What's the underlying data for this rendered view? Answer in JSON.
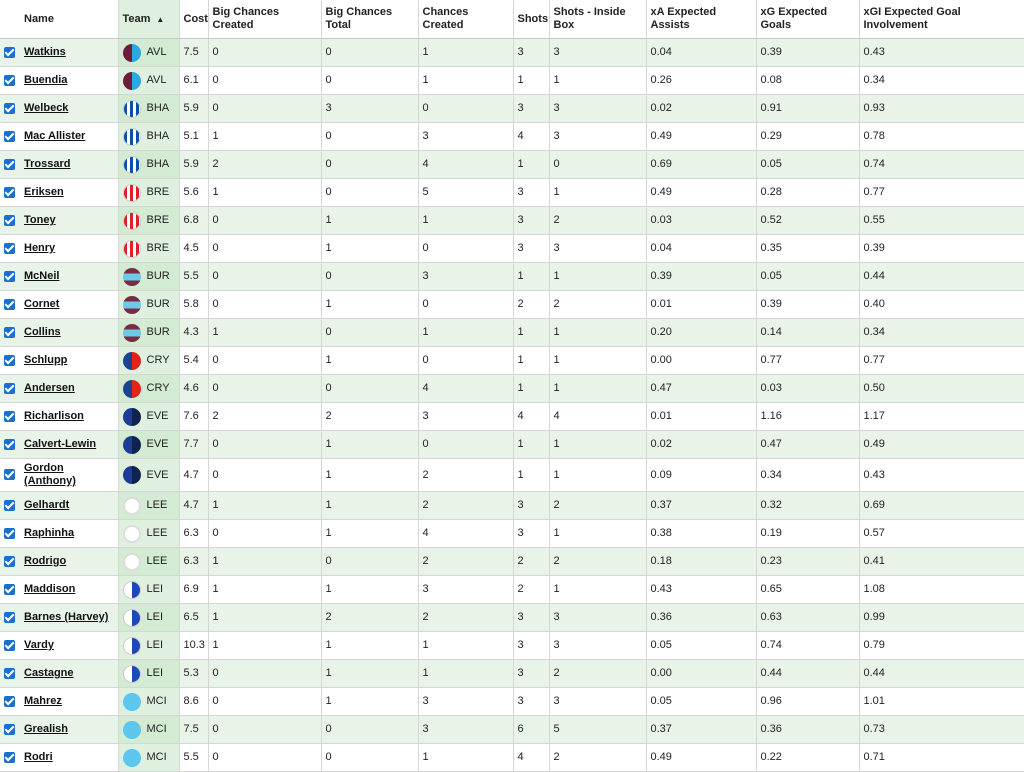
{
  "columns": {
    "name": "Name",
    "team": "Team",
    "sort_arrow": "▲",
    "cost": "Cost",
    "big_chances_created": "Big Chances Created",
    "big_chances_total": "Big Chances Total",
    "chances_created": "Chances Created",
    "shots": "Shots",
    "shots_inside_box": "Shots - Inside Box",
    "xa": "xA Expected Assists",
    "xg": "xG Expected Goals",
    "xgi": "xGI Expected Goal Involvement"
  },
  "team_colors": {
    "AVL": {
      "a": "#6d1d3c",
      "b": "#27a9e1"
    },
    "BHA": {
      "a": "#0b4fa8",
      "b": "#ffffff"
    },
    "BRE": {
      "a": "#e31e24",
      "b": "#ffffff"
    },
    "BUR": {
      "a": "#7b2a43",
      "b": "#6ccbe9"
    },
    "CRY": {
      "a": "#1b458f",
      "b": "#e2231a"
    },
    "EVE": {
      "a": "#1c3d91",
      "b": "#10234f"
    },
    "LEE": {
      "a": "#ffffff",
      "b": "#cccccc"
    },
    "LEI": {
      "a": "#ffffff",
      "b": "#1b47b8"
    },
    "MCI": {
      "a": "#5cc6ee",
      "b": "#5cc6ee"
    }
  },
  "rows": [
    {
      "name": "Watkins",
      "team": "AVL",
      "cost": "7.5",
      "bcc": "0",
      "bct": "0",
      "cc": "1",
      "shots": "3",
      "sib": "3",
      "xa": "0.04",
      "xg": "0.39",
      "xgi": "0.43"
    },
    {
      "name": "Buendia",
      "team": "AVL",
      "cost": "6.1",
      "bcc": "0",
      "bct": "0",
      "cc": "1",
      "shots": "1",
      "sib": "1",
      "xa": "0.26",
      "xg": "0.08",
      "xgi": "0.34"
    },
    {
      "name": "Welbeck",
      "team": "BHA",
      "cost": "5.9",
      "bcc": "0",
      "bct": "3",
      "cc": "0",
      "shots": "3",
      "sib": "3",
      "xa": "0.02",
      "xg": "0.91",
      "xgi": "0.93"
    },
    {
      "name": "Mac Allister",
      "team": "BHA",
      "cost": "5.1",
      "bcc": "1",
      "bct": "0",
      "cc": "3",
      "shots": "4",
      "sib": "3",
      "xa": "0.49",
      "xg": "0.29",
      "xgi": "0.78"
    },
    {
      "name": "Trossard",
      "team": "BHA",
      "cost": "5.9",
      "bcc": "2",
      "bct": "0",
      "cc": "4",
      "shots": "1",
      "sib": "0",
      "xa": "0.69",
      "xg": "0.05",
      "xgi": "0.74"
    },
    {
      "name": "Eriksen",
      "team": "BRE",
      "cost": "5.6",
      "bcc": "1",
      "bct": "0",
      "cc": "5",
      "shots": "3",
      "sib": "1",
      "xa": "0.49",
      "xg": "0.28",
      "xgi": "0.77"
    },
    {
      "name": "Toney",
      "team": "BRE",
      "cost": "6.8",
      "bcc": "0",
      "bct": "1",
      "cc": "1",
      "shots": "3",
      "sib": "2",
      "xa": "0.03",
      "xg": "0.52",
      "xgi": "0.55"
    },
    {
      "name": "Henry",
      "team": "BRE",
      "cost": "4.5",
      "bcc": "0",
      "bct": "1",
      "cc": "0",
      "shots": "3",
      "sib": "3",
      "xa": "0.04",
      "xg": "0.35",
      "xgi": "0.39"
    },
    {
      "name": "McNeil",
      "team": "BUR",
      "cost": "5.5",
      "bcc": "0",
      "bct": "0",
      "cc": "3",
      "shots": "1",
      "sib": "1",
      "xa": "0.39",
      "xg": "0.05",
      "xgi": "0.44"
    },
    {
      "name": "Cornet",
      "team": "BUR",
      "cost": "5.8",
      "bcc": "0",
      "bct": "1",
      "cc": "0",
      "shots": "2",
      "sib": "2",
      "xa": "0.01",
      "xg": "0.39",
      "xgi": "0.40"
    },
    {
      "name": "Collins",
      "team": "BUR",
      "cost": "4.3",
      "bcc": "1",
      "bct": "0",
      "cc": "1",
      "shots": "1",
      "sib": "1",
      "xa": "0.20",
      "xg": "0.14",
      "xgi": "0.34"
    },
    {
      "name": "Schlupp",
      "team": "CRY",
      "cost": "5.4",
      "bcc": "0",
      "bct": "1",
      "cc": "0",
      "shots": "1",
      "sib": "1",
      "xa": "0.00",
      "xg": "0.77",
      "xgi": "0.77"
    },
    {
      "name": "Andersen",
      "team": "CRY",
      "cost": "4.6",
      "bcc": "0",
      "bct": "0",
      "cc": "4",
      "shots": "1",
      "sib": "1",
      "xa": "0.47",
      "xg": "0.03",
      "xgi": "0.50"
    },
    {
      "name": "Richarlison",
      "team": "EVE",
      "cost": "7.6",
      "bcc": "2",
      "bct": "2",
      "cc": "3",
      "shots": "4",
      "sib": "4",
      "xa": "0.01",
      "xg": "1.16",
      "xgi": "1.17"
    },
    {
      "name": "Calvert-Lewin",
      "team": "EVE",
      "cost": "7.7",
      "bcc": "0",
      "bct": "1",
      "cc": "0",
      "shots": "1",
      "sib": "1",
      "xa": "0.02",
      "xg": "0.47",
      "xgi": "0.49"
    },
    {
      "name": "Gordon (Anthony)",
      "team": "EVE",
      "cost": "4.7",
      "bcc": "0",
      "bct": "1",
      "cc": "2",
      "shots": "1",
      "sib": "1",
      "xa": "0.09",
      "xg": "0.34",
      "xgi": "0.43"
    },
    {
      "name": "Gelhardt",
      "team": "LEE",
      "cost": "4.7",
      "bcc": "1",
      "bct": "1",
      "cc": "2",
      "shots": "3",
      "sib": "2",
      "xa": "0.37",
      "xg": "0.32",
      "xgi": "0.69"
    },
    {
      "name": "Raphinha",
      "team": "LEE",
      "cost": "6.3",
      "bcc": "0",
      "bct": "1",
      "cc": "4",
      "shots": "3",
      "sib": "1",
      "xa": "0.38",
      "xg": "0.19",
      "xgi": "0.57"
    },
    {
      "name": "Rodrigo",
      "team": "LEE",
      "cost": "6.3",
      "bcc": "1",
      "bct": "0",
      "cc": "2",
      "shots": "2",
      "sib": "2",
      "xa": "0.18",
      "xg": "0.23",
      "xgi": "0.41"
    },
    {
      "name": "Maddison",
      "team": "LEI",
      "cost": "6.9",
      "bcc": "1",
      "bct": "1",
      "cc": "3",
      "shots": "2",
      "sib": "1",
      "xa": "0.43",
      "xg": "0.65",
      "xgi": "1.08"
    },
    {
      "name": "Barnes (Harvey)",
      "team": "LEI",
      "cost": "6.5",
      "bcc": "1",
      "bct": "2",
      "cc": "2",
      "shots": "3",
      "sib": "3",
      "xa": "0.36",
      "xg": "0.63",
      "xgi": "0.99"
    },
    {
      "name": "Vardy",
      "team": "LEI",
      "cost": "10.3",
      "bcc": "1",
      "bct": "1",
      "cc": "1",
      "shots": "3",
      "sib": "3",
      "xa": "0.05",
      "xg": "0.74",
      "xgi": "0.79"
    },
    {
      "name": "Castagne",
      "team": "LEI",
      "cost": "5.3",
      "bcc": "0",
      "bct": "1",
      "cc": "1",
      "shots": "3",
      "sib": "2",
      "xa": "0.00",
      "xg": "0.44",
      "xgi": "0.44"
    },
    {
      "name": "Mahrez",
      "team": "MCI",
      "cost": "8.6",
      "bcc": "0",
      "bct": "1",
      "cc": "3",
      "shots": "3",
      "sib": "3",
      "xa": "0.05",
      "xg": "0.96",
      "xgi": "1.01"
    },
    {
      "name": "Grealish",
      "team": "MCI",
      "cost": "7.5",
      "bcc": "0",
      "bct": "0",
      "cc": "3",
      "shots": "6",
      "sib": "5",
      "xa": "0.37",
      "xg": "0.36",
      "xgi": "0.73"
    },
    {
      "name": "Rodri",
      "team": "MCI",
      "cost": "5.5",
      "bcc": "0",
      "bct": "0",
      "cc": "1",
      "shots": "4",
      "sib": "2",
      "xa": "0.49",
      "xg": "0.22",
      "xgi": "0.71"
    }
  ]
}
